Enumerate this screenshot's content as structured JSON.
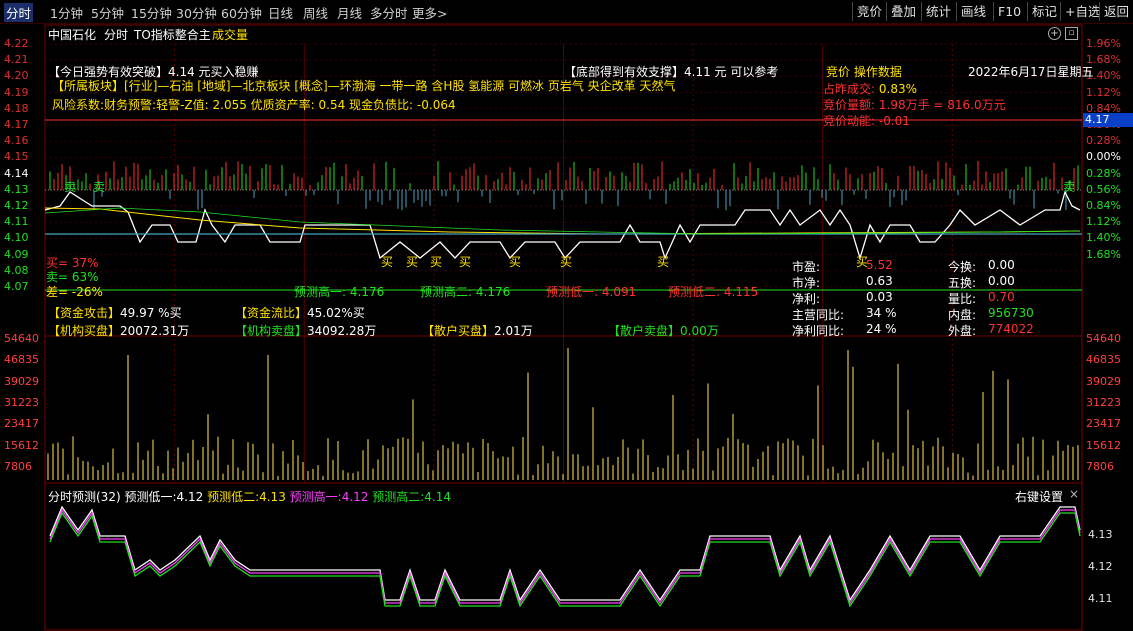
{
  "toolbar": {
    "left_items": [
      "分时",
      "1分钟",
      "5分钟",
      "15分钟",
      "30分钟",
      "60分钟",
      "日线",
      "周线",
      "月线",
      "多分时",
      "更多>"
    ],
    "right_items": [
      "竞价",
      "叠加",
      "统计",
      "画线",
      "F10",
      "标记",
      "+自选",
      "返回"
    ]
  },
  "header": {
    "stock": "中国石化",
    "mode": "分时",
    "indicator": "TO指标整合主",
    "volume_label": "成交量"
  },
  "price_axis": {
    "left": [
      "4.22",
      "4.21",
      "4.20",
      "4.19",
      "4.18",
      "4.17",
      "4.16",
      "4.15",
      "4.14",
      "4.13",
      "4.12",
      "4.11",
      "4.10",
      "4.09",
      "4.08",
      "4.07"
    ],
    "right": [
      "1.96%",
      "1.68%",
      "1.40%",
      "1.12%",
      "0.84%",
      "0.56%",
      "0.28%",
      "0.00%",
      "0.28%",
      "0.56%",
      "0.84%",
      "1.12%",
      "1.40%",
      "1.68%"
    ],
    "current_price": "4.17"
  },
  "volume_axis": {
    "ticks": [
      "54640",
      "46835",
      "39029",
      "31223",
      "23417",
      "15612",
      "7806"
    ]
  },
  "forecast_axis": {
    "ticks": [
      "4.13",
      "4.12",
      "4.11"
    ]
  },
  "info": {
    "line1_a": "【今日强势有效突破】4.14 元买入稳赚",
    "line1_b": "【底部得到有效支撑】4.11 元 可以参考",
    "line1_c": "竞价 操作数据",
    "date": "2022年6月17日星期五",
    "line2_label": "【所属板块】",
    "line2_text": "[行业]—石油 [地域]—北京板块 [概念]—环渤海 一带一路 含H股 氢能源 可燃冰 页岩气 央企改革 天然气",
    "line3": "风险系数:财务预警:轻警-Z值: 2.055 优质资产率: 0.54 现金负债比: -0.064",
    "auction": [
      {
        "label": "占昨成交:",
        "value": "0.83%"
      },
      {
        "label": "竞价量额:",
        "value": "1.98万手 = 816.0万元"
      },
      {
        "label": "竞价动能:",
        "value": "-0.01"
      }
    ]
  },
  "lower_left": {
    "buy": "买= 37%",
    "sell": "卖= 63%",
    "diff": "差= -26%"
  },
  "forecast_row": [
    {
      "label": "预测高一",
      "value": "4.176"
    },
    {
      "label": "预测高二",
      "value": "4.176"
    },
    {
      "label": "预测低一",
      "value": "4.091"
    },
    {
      "label": "预测低二",
      "value": "4.115"
    }
  ],
  "funds": {
    "attack_label": "【资金攻击】",
    "attack_value": "49.97 %买",
    "flow_label": "【资金流比】",
    "flow_value": "45.02%买",
    "inst_buy_label": "【机构买盘】",
    "inst_buy_value": "20072.31万",
    "inst_sell_label": "【机构卖盘】",
    "inst_sell_value": "34092.28万",
    "retail_buy_label": "【散户买盘】",
    "retail_buy_value": "2.01万",
    "retail_sell_label": "【散户卖盘】",
    "retail_sell_value": "0.00万"
  },
  "stats_left": [
    {
      "label": "市盈:",
      "value": "5.52"
    },
    {
      "label": "市净:",
      "value": "0.63"
    },
    {
      "label": "净利:",
      "value": "0.03"
    },
    {
      "label": "主营同比:",
      "value": "34 %"
    },
    {
      "label": "净利同比:",
      "value": "24 %"
    }
  ],
  "stats_right": [
    {
      "label": "今换:",
      "value": "0.00"
    },
    {
      "label": "五换:",
      "value": "0.00"
    },
    {
      "label": "量比:",
      "value": "0.70"
    },
    {
      "label": "内盘:",
      "value": "956730"
    },
    {
      "label": "外盘:",
      "value": "774022"
    }
  ],
  "forecast_panel": {
    "title": "分时预测(32)",
    "items": [
      {
        "label": "预测低一:",
        "value": "4.12"
      },
      {
        "label": "预测低二:",
        "value": "4.13"
      },
      {
        "label": "预测高一:",
        "value": "4.12"
      },
      {
        "label": "预测高二:",
        "value": "4.14"
      }
    ],
    "settings": "右键设置",
    "close": "×"
  },
  "signals": {
    "buy": "买",
    "sell": "卖"
  },
  "colors": {
    "frame": "#7a0000",
    "price_line": "#ffffff",
    "avg_line": "#ffe000",
    "up": "#ff3030",
    "down": "#20e020",
    "cyan_bar": "#4aa0c0"
  }
}
